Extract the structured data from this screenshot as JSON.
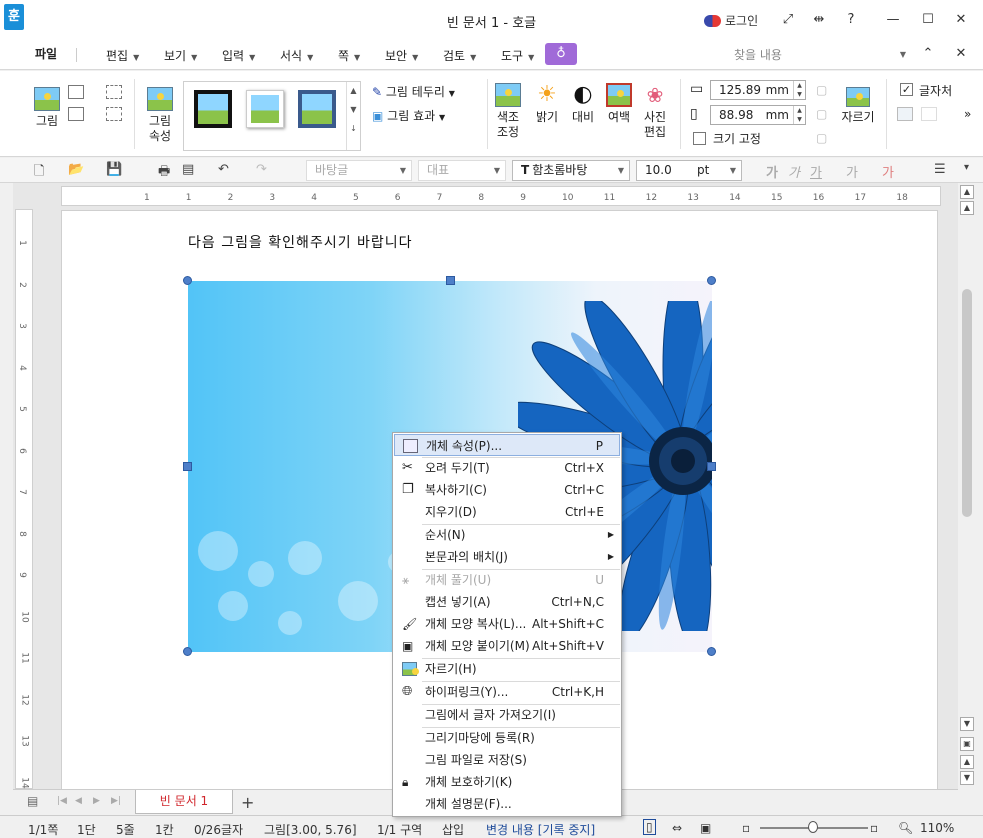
{
  "window": {
    "app_icon": "훈",
    "title": "빈 문서 1 - 호글",
    "login": "로그인",
    "controls": {
      "expand": "⤢",
      "fit": "⇹",
      "help": "?",
      "minimize": "—",
      "maximize": "☐",
      "close": "✕"
    }
  },
  "menu": {
    "file": "파일",
    "items": [
      "편집",
      "보기",
      "입력",
      "서식",
      "쪽",
      "보안",
      "검토",
      "도구"
    ],
    "find_placeholder": "찾을 내용",
    "collapse": "⌃",
    "close": "✕"
  },
  "ribbon": {
    "picture": "그림",
    "picture_props_1": "그림",
    "picture_props_2": "속성",
    "border": "그림 테두리",
    "effect": "그림 효과",
    "color_adjust_1": "색조",
    "color_adjust_2": "조정",
    "brightness": "밝기",
    "contrast": "대비",
    "margin": "여백",
    "photo_edit_1": "사진",
    "photo_edit_2": "편집",
    "width_value": "125.89",
    "height_value": "88.98",
    "unit": "mm",
    "size_lock": "크기 고정",
    "crop": "자르기",
    "wrap_text": "글자처",
    "more": "»"
  },
  "toolbar": {
    "style": "바탕글",
    "outline": "대표",
    "font": "함초롬바탕",
    "font_prefix": "T",
    "size": "10.0",
    "size_unit": "pt",
    "char1": "가",
    "char2": "가",
    "char3": "가",
    "char4": "가",
    "char5": "가"
  },
  "ruler": {
    "h_ticks": [
      "1",
      "1",
      "2",
      "3",
      "4",
      "5",
      "6",
      "7",
      "8",
      "9",
      "10",
      "11",
      "12",
      "13",
      "14",
      "15",
      "16",
      "17",
      "18"
    ],
    "v_ticks": [
      "1",
      "2",
      "3",
      "4",
      "5",
      "6",
      "7",
      "8",
      "9",
      "10",
      "11",
      "12",
      "13",
      "14"
    ]
  },
  "document": {
    "body_text": "다음 그림을 확인해주시기 바랍니다"
  },
  "context_menu": {
    "items": [
      {
        "label": "개체 속성(P)...",
        "shortcut": "P",
        "icon": "object-properties-icon",
        "state": "highlighted"
      },
      {
        "label": "오려 두기(T)",
        "shortcut": "Ctrl+X",
        "icon": "scissors-icon"
      },
      {
        "label": "복사하기(C)",
        "shortcut": "Ctrl+C",
        "icon": "copy-icon"
      },
      {
        "label": "지우기(D)",
        "shortcut": "Ctrl+E",
        "icon": ""
      },
      {
        "label": "순서(N)",
        "shortcut": "",
        "submenu": true,
        "icon": ""
      },
      {
        "label": "본문과의 배치(J)",
        "shortcut": "",
        "submenu": true,
        "icon": ""
      },
      {
        "label": "개체 풀기(U)",
        "shortcut": "U",
        "icon": "ungroup-icon",
        "state": "disabled"
      },
      {
        "label": "캡션 넣기(A)",
        "shortcut": "Ctrl+N,C",
        "icon": ""
      },
      {
        "label": "개체 모양 복사(L)...",
        "shortcut": "Alt+Shift+C",
        "icon": "copy-shape-icon"
      },
      {
        "label": "개체 모양 붙이기(M)",
        "shortcut": "Alt+Shift+V",
        "icon": "paste-shape-icon"
      },
      {
        "label": "자르기(H)",
        "shortcut": "",
        "icon": "crop-icon"
      },
      {
        "label": "하이퍼링크(Y)...",
        "shortcut": "Ctrl+K,H",
        "icon": "hyperlink-icon"
      },
      {
        "label": "그림에서 글자 가져오기(I)",
        "shortcut": "",
        "icon": ""
      },
      {
        "label": "그리기마당에 등록(R)",
        "shortcut": "",
        "icon": ""
      },
      {
        "label": "그림 파일로 저장(S)",
        "shortcut": "",
        "icon": ""
      },
      {
        "label": "개체 보호하기(K)",
        "shortcut": "",
        "icon": "lock-icon"
      },
      {
        "label": "개체 설명문(F)...",
        "shortcut": "",
        "icon": ""
      }
    ]
  },
  "tabs": {
    "active": "빈 문서 1",
    "add": "+"
  },
  "status": {
    "page": "1/1쪽",
    "column": "1단",
    "line": "5줄",
    "pos": "1칸",
    "chars": "0/26글자",
    "object": "그림[3.00, 5.76]",
    "section": "1/1 구역",
    "mode": "삽입",
    "track": "변경 내용 [기록 중지]",
    "zoom": "110%"
  },
  "colors": {
    "accent_blue": "#1a8fd8",
    "selection_handle": "#4e7fc9",
    "tab_text_red": "#d0252b",
    "menu_highlight": "#dde8f8",
    "purple_button": "#a06ad8"
  }
}
